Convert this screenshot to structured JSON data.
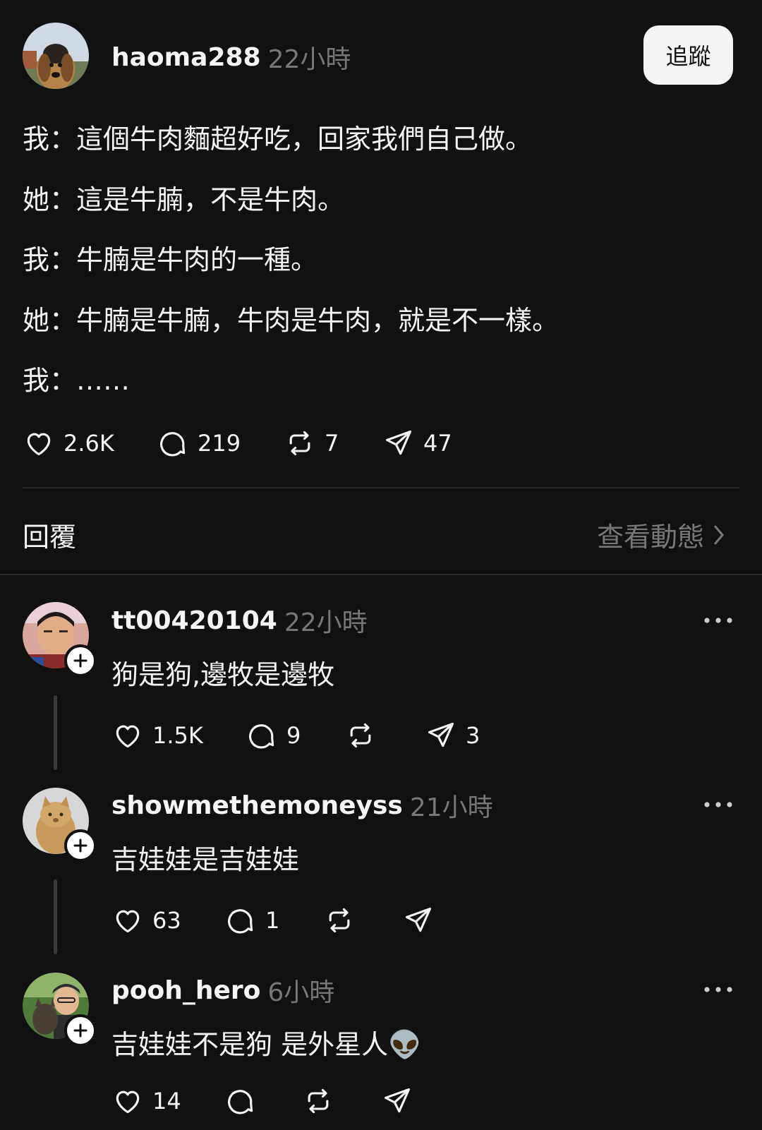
{
  "post": {
    "username": "haoma288",
    "time": "22小時",
    "follow_label": "追蹤",
    "lines": [
      "我：這個牛肉麵超好吃，回家我們自己做。",
      "她：這是牛腩，不是牛肉。",
      "我：牛腩是牛肉的一種。",
      "她：牛腩是牛腩，牛肉是牛肉，就是不一樣。",
      "我：……"
    ],
    "likes": "2.6K",
    "comments": "219",
    "reposts": "7",
    "shares": "47"
  },
  "section": {
    "replies_label": "回覆",
    "view_activity_label": "查看動態"
  },
  "replies": [
    {
      "username": "tt00420104",
      "time": "22小時",
      "text": "狗是狗,邊牧是邊牧",
      "likes": "1.5K",
      "comments": "9",
      "reposts": "",
      "shares": "3"
    },
    {
      "username": "showmethemoneyss",
      "time": "21小時",
      "text": "吉娃娃是吉娃娃",
      "likes": "63",
      "comments": "1",
      "reposts": "",
      "shares": ""
    },
    {
      "username": "pooh_hero",
      "time": "6小時",
      "text": "吉娃娃不是狗 是外星人👽",
      "likes": "14",
      "comments": "",
      "reposts": "",
      "shares": ""
    }
  ],
  "icons": {
    "like": "heart-icon",
    "comment": "comment-bubble-icon",
    "repost": "repost-icon",
    "share": "send-icon",
    "more": "more-horizontal-icon",
    "follow": "plus-icon",
    "chevron": "chevron-right-icon"
  },
  "colors": {
    "background": "#111112",
    "text": "#f3f5f7",
    "muted": "#777777",
    "divider": "#2a2a2c"
  }
}
